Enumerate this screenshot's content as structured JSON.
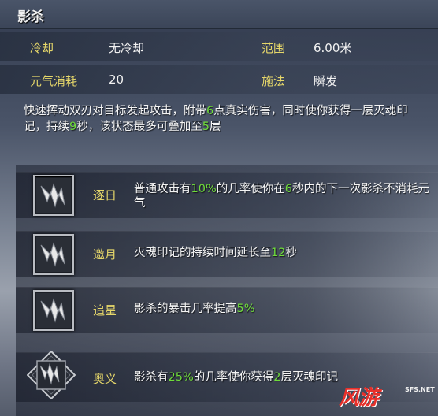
{
  "title": "影杀",
  "stats": {
    "cooldown_label": "冷却",
    "cooldown_value": "无冷却",
    "range_label": "范围",
    "range_value": "6.00米",
    "cost_label": "元气消耗",
    "cost_value": "20",
    "cast_label": "施法",
    "cast_value": "瞬发"
  },
  "description": {
    "p1": "快速挥动双刃对目标发起攻击，附带",
    "h1": "6",
    "p2": "点真实伤害，同时使你获得一层灭魂印记，持续",
    "h2": "9",
    "p3": "秒，该状态最多可叠加至",
    "h3": "5",
    "p4": "层"
  },
  "passives": [
    {
      "name": "逐日",
      "t1": "普通攻击有",
      "h1": "10%",
      "t2": "的几率使你在",
      "h2": "6",
      "t3": "秒内的下一次影杀不消耗元气",
      "icon": "blade-slash-icon"
    },
    {
      "name": "邀月",
      "t1": "灭魂印记的持续时间延长至",
      "h1": "12",
      "t2": "秒",
      "icon": "blade-slash-icon"
    },
    {
      "name": "追星",
      "t1": "影杀的暴击几率提高",
      "h1": "5%",
      "icon": "blade-slash-icon"
    },
    {
      "name": "奥义",
      "t1": "影杀有",
      "h1": "25%",
      "t2": "的几率使你获得",
      "h2": "2",
      "t3": "层灭魂印记",
      "icon": "blade-slash-icon"
    }
  ],
  "watermark": {
    "brand": "风游",
    "site": "SFS.NET"
  },
  "colors": {
    "label": "#e6d76a",
    "highlight": "#6fdc3a",
    "watermark": "#e8302a"
  }
}
